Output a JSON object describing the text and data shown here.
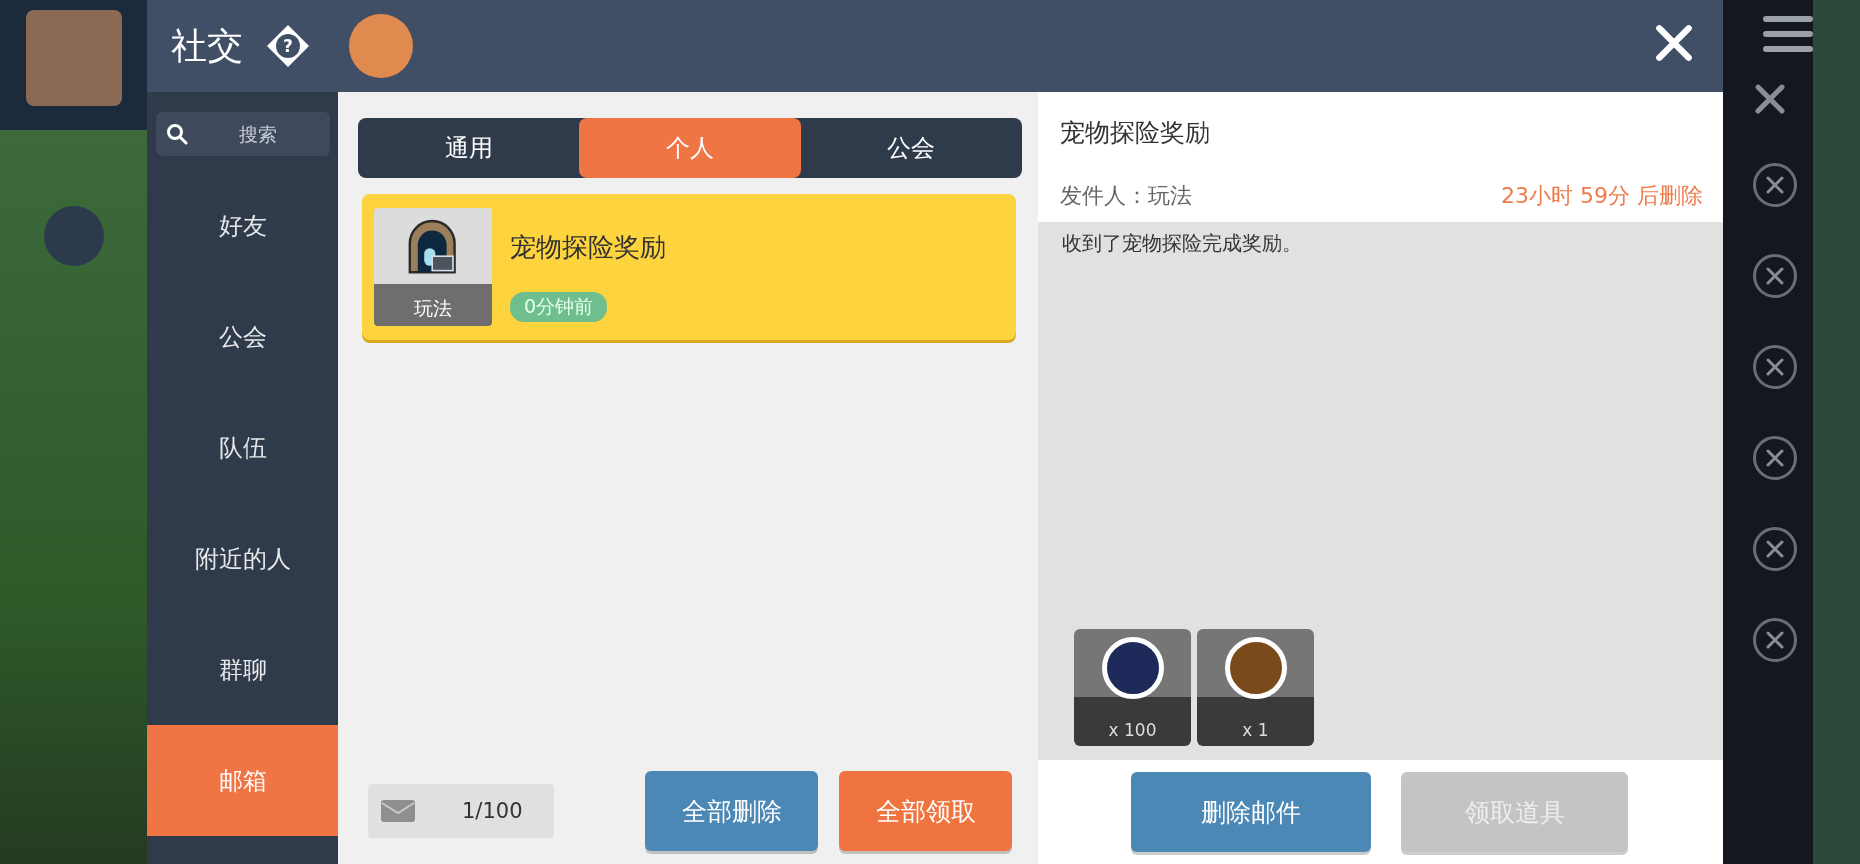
{
  "dialog": {
    "title": "社交",
    "help": "?",
    "search": {
      "placeholder": "搜索"
    },
    "sidebar": {
      "items": [
        {
          "label": "好友",
          "selected": false
        },
        {
          "label": "公会",
          "selected": false
        },
        {
          "label": "队伍",
          "selected": false
        },
        {
          "label": "附近的人",
          "selected": false
        },
        {
          "label": "群聊",
          "selected": false
        },
        {
          "label": "邮箱",
          "selected": true
        }
      ]
    },
    "tabs": [
      {
        "label": "通用",
        "selected": false
      },
      {
        "label": "个人",
        "selected": true
      },
      {
        "label": "公会",
        "selected": false
      }
    ],
    "mails": [
      {
        "title": "宠物探险奖励",
        "sender_tag": "玩法",
        "time": "0分钟前",
        "selected": true
      }
    ],
    "mail_count": "1/100",
    "list_buttons": [
      {
        "label": "全部删除",
        "kind": "blue"
      },
      {
        "label": "全部领取",
        "kind": "orange"
      }
    ],
    "detail": {
      "title": "宠物探险奖励",
      "sender": "发件人：玩法",
      "expiry": "23小时 59分 后删除",
      "body": "收到了宠物探险完成奖励。",
      "rewards": [
        {
          "count": "x 100",
          "color": "#1e2a5a"
        },
        {
          "count": "x 1",
          "color": "#7a4a1a"
        }
      ],
      "buttons": [
        {
          "label": "删除邮件",
          "disabled": false
        },
        {
          "label": "领取道具",
          "disabled": true
        }
      ]
    }
  }
}
